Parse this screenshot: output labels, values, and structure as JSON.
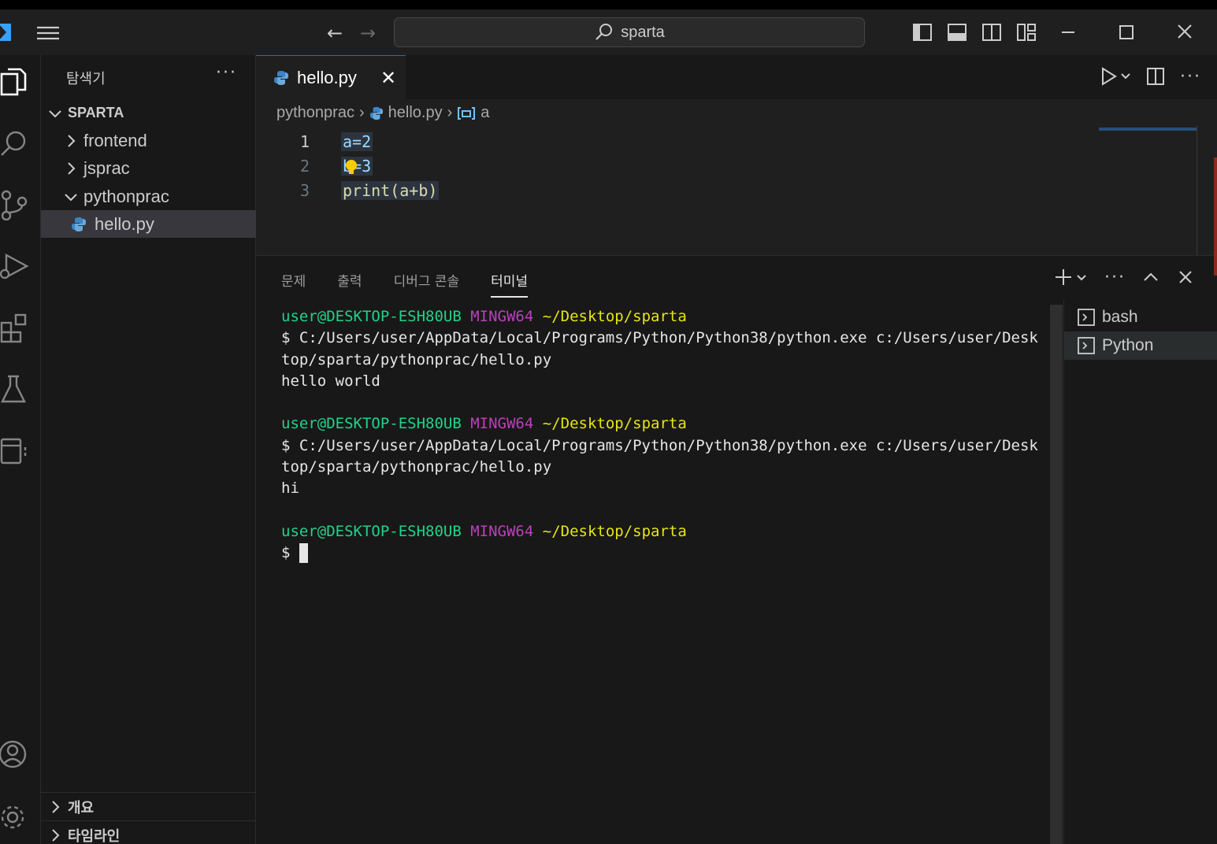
{
  "titlebar": {
    "search_text": "sparta"
  },
  "sidebar": {
    "title": "탐색기",
    "more": "···",
    "root": "SPARTA",
    "items": [
      {
        "label": "frontend"
      },
      {
        "label": "jsprac"
      },
      {
        "label": "pythonprac"
      },
      {
        "label": "hello.py"
      }
    ],
    "bottom": [
      {
        "label": "개요"
      },
      {
        "label": "타임라인"
      }
    ]
  },
  "editor": {
    "tab_label": "hello.py",
    "breadcrumb": [
      "pythonprac",
      "hello.py",
      "a"
    ],
    "lines": [
      {
        "num": "1",
        "text": "a=2"
      },
      {
        "num": "2",
        "text": "b=3"
      },
      {
        "num": "3",
        "text": "print(a+b)"
      }
    ]
  },
  "panel": {
    "tabs": [
      "문제",
      "출력",
      "디버그 콘솔",
      "터미널"
    ],
    "active_tab": "터미널",
    "terminal": {
      "user": "user@DESKTOP-ESH80UB",
      "mingw": "MINGW64",
      "path": "~/Desktop/sparta",
      "cmd": "$ C:/Users/user/AppData/Local/Programs/Python/Python38/python.exe c:/Users/user/Desktop/sparta/pythonprac/hello.py",
      "out1": "hello world",
      "out2": "hi",
      "prompt": "$"
    },
    "terminals": [
      {
        "label": "bash"
      },
      {
        "label": "Python"
      }
    ]
  },
  "colors": {
    "accent": "#0078d4",
    "terminal_user": "#23d18b",
    "terminal_mingw": "#bc3fbc",
    "terminal_path": "#e5e510"
  }
}
